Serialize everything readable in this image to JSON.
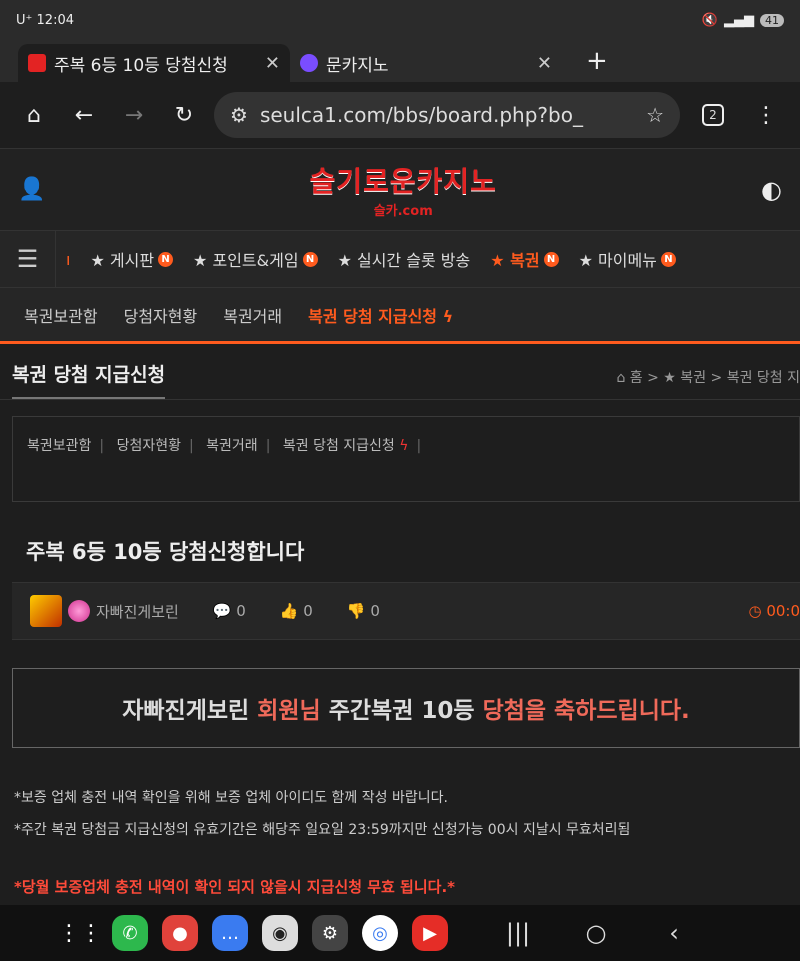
{
  "status": {
    "time": "12:04",
    "carrier": "U⁺",
    "battery": "41"
  },
  "tabs": [
    {
      "title": "주복 6등 10등 당첨신청",
      "favicon_color": "#e32323"
    },
    {
      "title": "문카지노",
      "favicon_color": "#7a4dff"
    }
  ],
  "toolbar": {
    "url": "seulca1.com/bbs/board.php?bo_",
    "tab_count": "2"
  },
  "site": {
    "logo_main": "슬기로운카지노",
    "logo_sub": "슬카.com"
  },
  "nav": [
    {
      "label": "★ 게시판",
      "badge": "N"
    },
    {
      "label": "★ 포인트&게임",
      "badge": "N"
    },
    {
      "label": "★ 실시간 슬롯 방송",
      "badge": ""
    },
    {
      "label": "★ 복권",
      "badge": "N"
    },
    {
      "label": "★ 마이메뉴",
      "badge": "N"
    }
  ],
  "subnav": [
    "복권보관함",
    "당첨자현황",
    "복권거래",
    "복권 당첨 지급신청"
  ],
  "page": {
    "title": "복권 당첨 지급신청",
    "breadcrumb": "홈 > ★ 복권 > 복권 당첨 지"
  },
  "submenu": [
    "복권보관함",
    "당첨자현황",
    "복권거래",
    "복권 당첨 지급신청"
  ],
  "post": {
    "title": "주복 6등 10등 당첨신청합니다",
    "author": "자빠진게보린",
    "comments": "0",
    "likes": "0",
    "dislikes": "0",
    "time": "00:0"
  },
  "congrats": {
    "name": "자빠진게보린",
    "p1": "회원님",
    "p2": "주간복권 10등",
    "p3": "당첨을 축하드립니다."
  },
  "notes": [
    "*보증 업체 충전 내역 확인을 위해 보증 업체 아이디도 함께 작성 바랍니다.",
    "*주간 복권 당첨금 지급신청의 유효기간은 해당주 일요일 23:59까지만 신청가능 00시 지날시 무효처리됨"
  ],
  "warning": "*당월 보증업체 충전 내역이 확인 되지 않을시 지급신청 무효 됩니다.*"
}
